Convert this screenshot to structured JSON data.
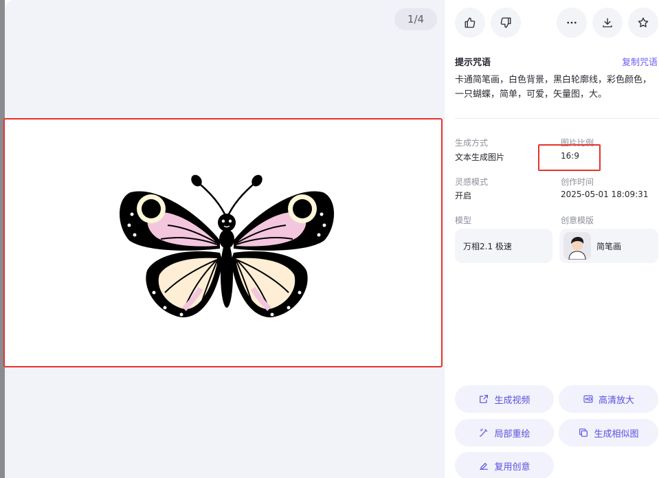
{
  "viewer": {
    "page_counter": "1/4"
  },
  "toolbar": {
    "like_icon": "thumbs-up-icon",
    "dislike_icon": "thumbs-down-icon",
    "more_icon": "more-icon",
    "download_icon": "download-icon",
    "favorite_icon": "star-icon"
  },
  "prompt": {
    "title": "提示咒语",
    "copy_label": "复制咒语",
    "text": "卡通简笔画，白色背景，黑白轮廓线，彩色颜色，一只蝴蝶，简单，可爱，矢量图，大。"
  },
  "details": {
    "gen_method_label": "生成方式",
    "gen_method_value": "文本生成图片",
    "ratio_label": "图片比例",
    "ratio_value": "16:9",
    "inspiration_label": "灵感模式",
    "inspiration_value": "开启",
    "created_label": "创作时间",
    "created_value": "2025-05-01 18:09:31",
    "model_label": "模型",
    "model_value": "万相2.1 极速",
    "template_label": "创意模版",
    "template_value": "简笔画"
  },
  "actions": {
    "generate_video": "生成视频",
    "hd_upscale": "高清放大",
    "partial_redraw": "局部重绘",
    "generate_similar": "生成相似图",
    "reuse_idea": "复用创意"
  },
  "colors": {
    "accent": "#6b5cf0",
    "highlight_border": "#e5322a",
    "wing_pink": "#f3c6dd",
    "wing_cream": "#fdeed5"
  }
}
